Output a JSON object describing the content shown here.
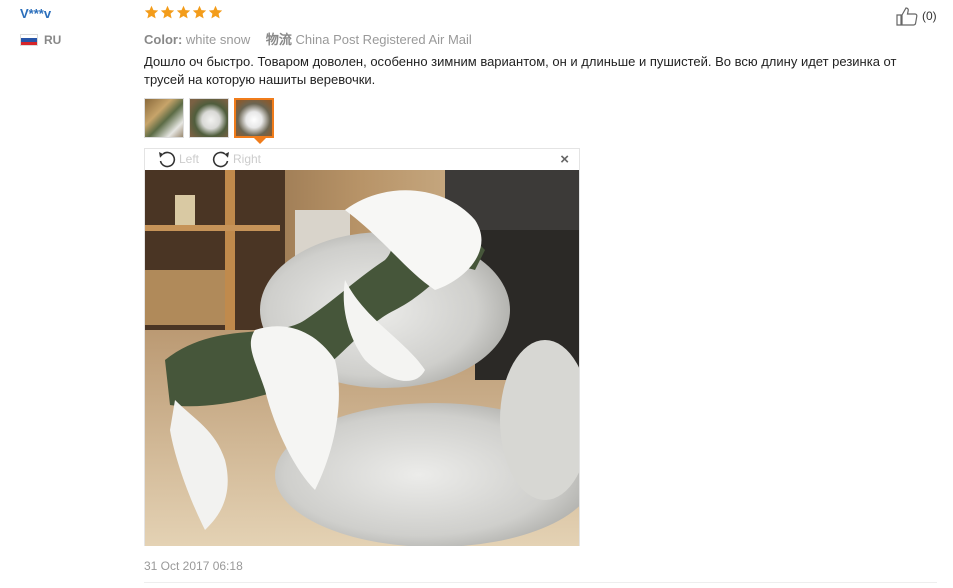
{
  "review": {
    "user": "V***v",
    "country": "RU",
    "rating": 5,
    "color_label": "Color:",
    "color_value": "white snow",
    "shipping_label": "物流",
    "shipping_value": "China Post Registered Air Mail",
    "helpful_count": "(0)",
    "text": "Дошло оч быстро. Товаром доволен, особенно зимним вариантом, он и длиньше и пушистей. Во всю длину идет резинка от трусей на которую нашиты веревочки.",
    "date": "31 Oct 2017 06:18"
  },
  "viewer": {
    "rotate_left_label": "Left",
    "rotate_right_label": "Right",
    "close_label": "×",
    "selected_thumbnail": 3
  },
  "thumbnails": [
    {
      "icon": "photo-thumbnail-1"
    },
    {
      "icon": "photo-thumbnail-2"
    },
    {
      "icon": "photo-thumbnail-3",
      "active": true
    }
  ],
  "colors": {
    "star": "#f39c1a",
    "active_border": "#f07c1b",
    "user_link": "#2a6ebb"
  }
}
